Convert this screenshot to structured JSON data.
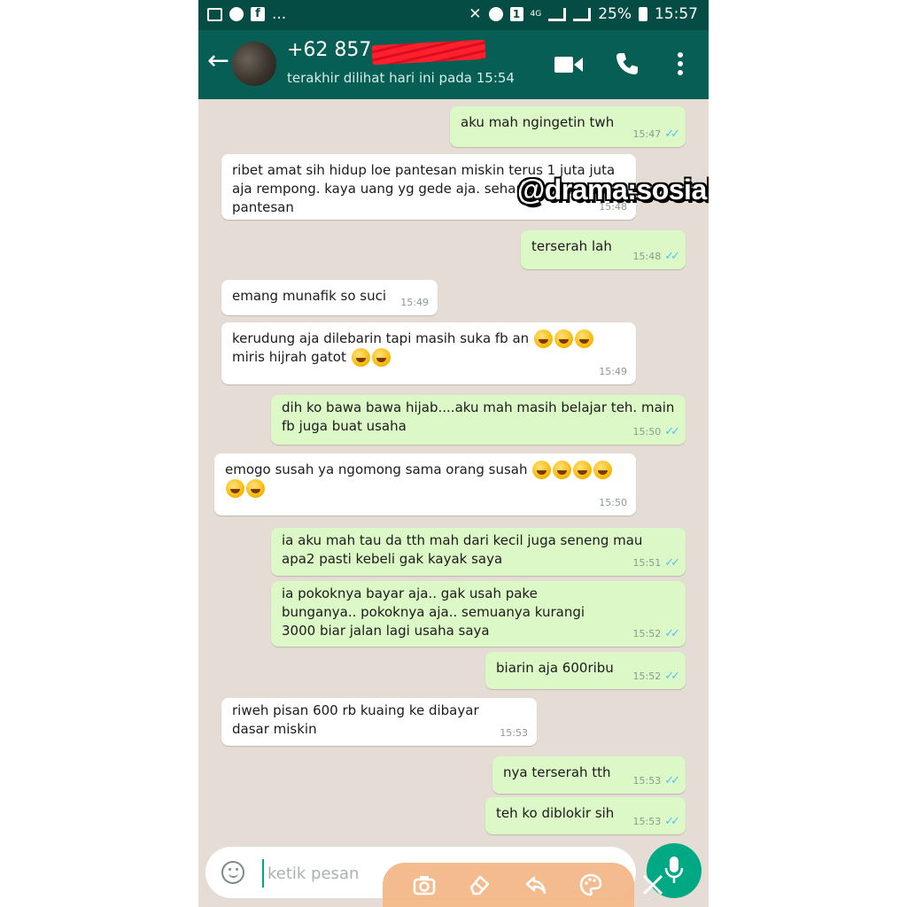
{
  "status_bar": {
    "icons_left": [
      "image-icon",
      "chrome-icon",
      "facebook-icon"
    ],
    "overflow": "...",
    "icons_right": [
      "mute-icon",
      "alarm-icon",
      "sim-icon",
      "4g-icon",
      "signal-icon",
      "signal-icon"
    ],
    "network": "4G",
    "battery": "25%",
    "time": "15:57"
  },
  "header": {
    "contact_name": "+62 857-",
    "last_seen": "terakhir dilihat hari ini pada 15:54",
    "colors": {
      "header": "#075e54",
      "status_bar": "#054d44"
    }
  },
  "watermark": "@drama:sosialmedia",
  "messages": [
    {
      "dir": "out",
      "text": "aku mah ngingetin twh",
      "time": "15:47",
      "read": true
    },
    {
      "dir": "in",
      "text": "ribet amat sih hidup loe pantesan miskin terus 1 juta juta aja rempong. kaya uang yg gede aja. seharga diri loe ya. pantesan",
      "time": "15:48"
    },
    {
      "dir": "out",
      "text": "terserah lah",
      "time": "15:48",
      "read": true
    },
    {
      "dir": "in",
      "text": "emang munafik so suci",
      "time": "15:49"
    },
    {
      "dir": "in",
      "text": "kerudung aja dilebarin tapi masih suka fb an",
      "emoji_after_line1": 3,
      "text2": "miris hijrah gatot",
      "emoji_after_line2": 2,
      "time": "15:49"
    },
    {
      "dir": "out",
      "text": "dih ko bawa bawa hijab....aku mah masih belajar teh. main fb juga buat usaha",
      "time": "15:50",
      "read": true
    },
    {
      "dir": "in",
      "text": "emogo susah ya ngomong sama orang susah",
      "emoji_after_line1": 4,
      "emoji_line2": 2,
      "time": "15:50"
    },
    {
      "dir": "out",
      "text": "ia aku mah tau da tth mah dari kecil juga seneng mau apa2 pasti kebeli gak kayak saya",
      "time": "15:51",
      "read": true
    },
    {
      "dir": "out",
      "text": "ia pokoknya bayar aja.. gak usah pake bunganya.. pokoknya aja.. semuanya kurangi 3000 biar jalan lagi usaha saya",
      "time": "15:52",
      "read": true
    },
    {
      "dir": "out",
      "text": "biarin aja 600ribu",
      "time": "15:52",
      "read": true
    },
    {
      "dir": "in",
      "text": "riweh pisan 600 rb kuaing ke dibayar dasar miskin",
      "time": "15:53"
    },
    {
      "dir": "out",
      "text": "nya terserah tth",
      "time": "15:53",
      "read": true
    },
    {
      "dir": "out",
      "text": "teh ko diblokir sih",
      "time": "15:53",
      "read": true
    }
  ],
  "input": {
    "placeholder": "ketik pesan"
  },
  "edit_bar_icons": [
    "camera-icon",
    "eraser-icon",
    "undo-icon",
    "palette-icon"
  ],
  "colors": {
    "incoming": "#ffffff",
    "outgoing": "#dcf8c6",
    "chat_bg": "#e5ddd5",
    "ticks": "#4fc3f7",
    "mic": "#00a884"
  }
}
